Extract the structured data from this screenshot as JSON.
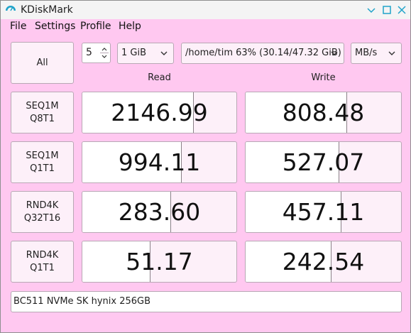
{
  "window": {
    "title": "KDiskMark"
  },
  "menu": [
    "File",
    "Settings",
    "Profile",
    "Help"
  ],
  "controls": {
    "all_label": "All",
    "loops": "5",
    "size": "1 GiB",
    "target": "/home/tim 63% (30.14/47.32 GiB)",
    "unit": "MB/s"
  },
  "headers": {
    "read": "Read",
    "write": "Write"
  },
  "rows": [
    {
      "line1": "SEQ1M",
      "line2": "Q8T1",
      "read": "2146.99",
      "write": "808.48",
      "read_fill": 0.72,
      "write_fill": 0.65
    },
    {
      "line1": "SEQ1M",
      "line2": "Q1T1",
      "read": "994.11",
      "write": "527.07",
      "read_fill": 0.64,
      "write_fill": 0.6
    },
    {
      "line1": "RND4K",
      "line2": "Q32T16",
      "read": "283.60",
      "write": "457.11",
      "read_fill": 0.57,
      "write_fill": 0.61
    },
    {
      "line1": "RND4K",
      "line2": "Q1T1",
      "read": "51.17",
      "write": "242.54",
      "read_fill": 0.44,
      "write_fill": 0.55
    }
  ],
  "device": "BC511 NVMe SK hynix 256GB",
  "colors": {
    "background": "#ffc8f0",
    "button": "#fdf0f9",
    "border": "#b8a8b5",
    "accent": "#1fa3c9"
  }
}
